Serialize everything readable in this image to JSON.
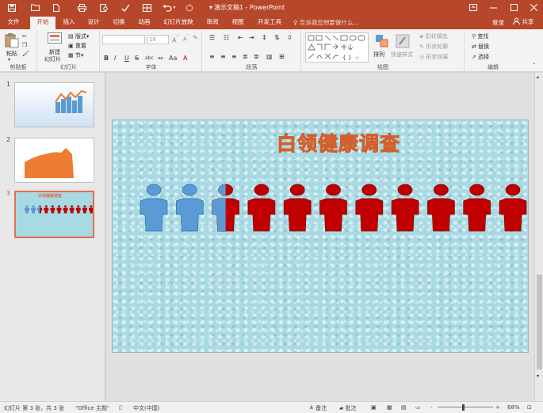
{
  "window": {
    "title": "演示文稿1 - PowerPoint"
  },
  "tabs": [
    {
      "label": "文件"
    },
    {
      "label": "开始"
    },
    {
      "label": "插入"
    },
    {
      "label": "设计"
    },
    {
      "label": "切换"
    },
    {
      "label": "动画"
    },
    {
      "label": "幻灯片放映"
    },
    {
      "label": "审阅"
    },
    {
      "label": "视图"
    },
    {
      "label": "开发工具"
    }
  ],
  "tell_me": "告诉我您想要做什么...",
  "account": {
    "login": "登录",
    "share": "共享"
  },
  "ribbon": {
    "clipboard": {
      "label": "剪贴板",
      "paste": "粘贴"
    },
    "slides": {
      "label": "幻灯片",
      "new_slide_1": "新建",
      "new_slide_2": "幻灯片",
      "layout": "版式",
      "reset": "重置",
      "section": "节"
    },
    "font": {
      "label": "字体",
      "size": "18",
      "bold": "B",
      "italic": "I",
      "underline": "U",
      "strike": "S",
      "shadow": "abc"
    },
    "paragraph": {
      "label": "段落"
    },
    "drawing": {
      "label": "绘图",
      "arrange": "排列",
      "quick_styles": "快速样式",
      "fill": "形状填充",
      "outline": "形状轮廓",
      "effects": "形状效果"
    },
    "editing": {
      "label": "编辑",
      "find": "查找",
      "replace": "替换",
      "select": "选择"
    }
  },
  "thumbnails": [
    {
      "number": "1"
    },
    {
      "number": "2"
    },
    {
      "number": "3",
      "mini_title": "白领健康调查"
    }
  ],
  "slide": {
    "title": "白领健康调查",
    "people_total": 11,
    "people_blue": 2.5,
    "colors": {
      "blue": "#5b9bd5",
      "red": "#c00000",
      "title": "#f4a374"
    }
  },
  "status": {
    "slide_info": "幻灯片 第 3 张，共 3 张",
    "theme": "\"Office 主题\"",
    "language": "中文(中国)",
    "notes": "备注",
    "comments": "批注",
    "zoom": "68%",
    "minus": "-",
    "plus": "+"
  },
  "accent": "#b7472a"
}
